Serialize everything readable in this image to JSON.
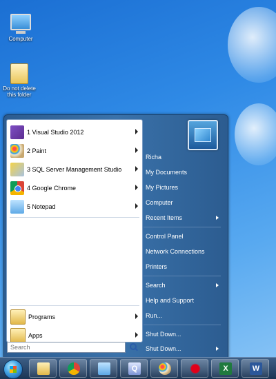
{
  "desktop": {
    "icons": [
      {
        "label": "Computer",
        "icon": "computer-icon"
      },
      {
        "label": "Do not delete this folder",
        "icon": "folder-icon"
      }
    ]
  },
  "start_menu": {
    "pinned": [
      {
        "label": "1 Visual Studio 2012",
        "icon": "visual-studio-icon",
        "has_submenu": true
      },
      {
        "label": "2 Paint",
        "icon": "paint-icon",
        "has_submenu": true
      },
      {
        "label": "3 SQL Server Management Studio",
        "icon": "sql-server-icon",
        "has_submenu": true
      },
      {
        "label": "4 Google Chrome",
        "icon": "chrome-icon",
        "has_submenu": true
      },
      {
        "label": "5 Notepad",
        "icon": "notepad-icon",
        "has_submenu": true
      }
    ],
    "programs_label": "Programs",
    "apps_label": "Apps",
    "search_placeholder": "Search",
    "user_name": "Richa",
    "right_items": [
      {
        "label": "My Documents"
      },
      {
        "label": "My Pictures"
      },
      {
        "label": "Computer"
      },
      {
        "label": "Recent Items",
        "has_submenu": true
      },
      {
        "label": "Control Panel"
      },
      {
        "label": "Network Connections"
      },
      {
        "label": "Printers"
      },
      {
        "label": "Search",
        "has_submenu": true
      },
      {
        "label": "Help and Support"
      },
      {
        "label": "Run..."
      },
      {
        "label": "Shut Down..."
      },
      {
        "label": "Shut Down...",
        "has_submenu": true
      }
    ]
  },
  "taskbar": {
    "buttons": [
      {
        "name": "file-explorer",
        "icon": "folder-icon"
      },
      {
        "name": "google-chrome",
        "icon": "chrome-icon"
      },
      {
        "name": "notepad",
        "icon": "notepad-icon"
      },
      {
        "name": "sql-server-management-studio",
        "icon": "sql-server-icon",
        "letter": "Q"
      },
      {
        "name": "paint",
        "icon": "paint-icon"
      },
      {
        "name": "red-splat-app",
        "icon": "splat-icon"
      },
      {
        "name": "excel",
        "icon": "excel-icon",
        "letter": "X"
      },
      {
        "name": "word",
        "icon": "word-icon",
        "letter": "W"
      }
    ]
  }
}
